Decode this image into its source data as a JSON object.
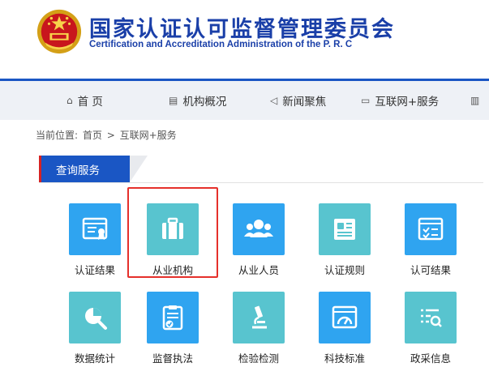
{
  "header": {
    "title": "国家认证认可监督管理委员会",
    "subtitle": "Certification and Accreditation Administration of the P. R. C",
    "emblem_icon": "national-emblem-icon"
  },
  "nav": {
    "items": [
      {
        "label": "首 页",
        "icon": "home-icon",
        "glyph": "⌂"
      },
      {
        "label": "机构概况",
        "icon": "document-icon",
        "glyph": "▤"
      },
      {
        "label": "新闻聚焦",
        "icon": "megaphone-icon",
        "glyph": "◁"
      },
      {
        "label": "互联网+服务",
        "icon": "monitor-icon",
        "glyph": "▭"
      },
      {
        "label": "",
        "icon": "more-icon",
        "glyph": "▥"
      }
    ]
  },
  "breadcrumb": {
    "prefix": "当前位置:",
    "home": "首页",
    "separator": ">",
    "current": "互联网+服务"
  },
  "section": {
    "title": "查询服务"
  },
  "tiles": [
    {
      "label": "认证结果",
      "icon": "certificate-icon"
    },
    {
      "label": "从业机构",
      "icon": "briefcase-icon",
      "selected": true
    },
    {
      "label": "从业人员",
      "icon": "people-icon"
    },
    {
      "label": "认证规则",
      "icon": "rules-card-icon"
    },
    {
      "label": "认可结果",
      "icon": "checklist-window-icon"
    },
    {
      "label": "数据统计",
      "icon": "data-search-icon"
    },
    {
      "label": "监督执法",
      "icon": "clipboard-check-icon"
    },
    {
      "label": "检验检测",
      "icon": "microscope-icon"
    },
    {
      "label": "科技标准",
      "icon": "gauge-window-icon"
    },
    {
      "label": "政采信息",
      "icon": "list-search-icon"
    }
  ],
  "colors": {
    "brand_blue": "#1a56c4",
    "title_blue": "#1a3fa8",
    "tile_blue": "#2fa4f0",
    "tile_teal": "#58c4cf",
    "highlight_red": "#e5302b"
  }
}
